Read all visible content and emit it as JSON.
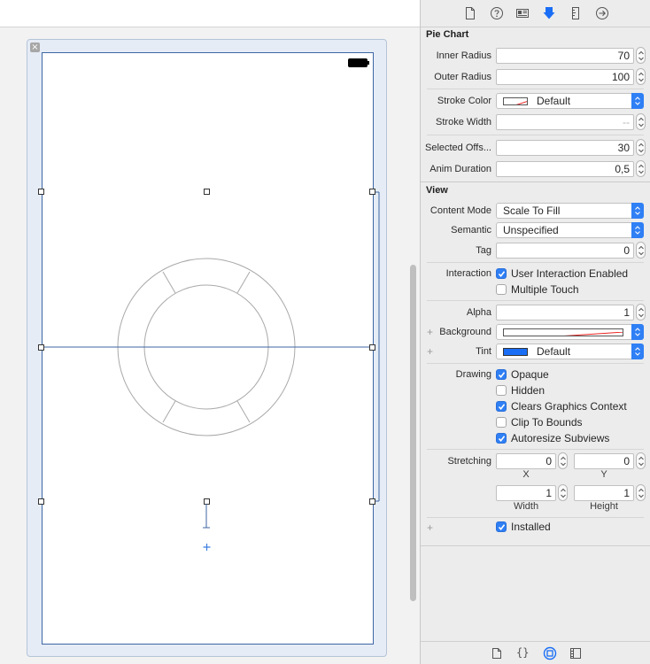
{
  "inspector": {
    "tabs": [
      "file-icon",
      "help-icon",
      "identity-icon",
      "attributes-icon",
      "size-icon",
      "connections-icon"
    ],
    "pie_chart": {
      "title": "Pie Chart",
      "inner_radius": {
        "label": "Inner Radius",
        "value": "70"
      },
      "outer_radius": {
        "label": "Outer Radius",
        "value": "100"
      },
      "stroke_color": {
        "label": "Stroke Color",
        "value": "Default"
      },
      "stroke_width": {
        "label": "Stroke Width",
        "placeholder": "--"
      },
      "selected_offset": {
        "label": "Selected Offs...",
        "value": "30"
      },
      "anim_duration": {
        "label": "Anim Duration",
        "value": "0,5"
      }
    },
    "view": {
      "title": "View",
      "content_mode": {
        "label": "Content Mode",
        "value": "Scale To Fill"
      },
      "semantic": {
        "label": "Semantic",
        "value": "Unspecified"
      },
      "tag": {
        "label": "Tag",
        "value": "0"
      },
      "interaction": {
        "label": "Interaction",
        "user_interaction": {
          "label": "User Interaction Enabled",
          "checked": true
        },
        "multiple_touch": {
          "label": "Multiple Touch",
          "checked": false
        }
      },
      "alpha": {
        "label": "Alpha",
        "value": "1"
      },
      "background": {
        "label": "Background"
      },
      "tint": {
        "label": "Tint",
        "value": "Default",
        "color": "#1a6ef5"
      },
      "drawing": {
        "label": "Drawing",
        "opaque": {
          "label": "Opaque",
          "checked": true
        },
        "hidden": {
          "label": "Hidden",
          "checked": false
        },
        "clears_graphics": {
          "label": "Clears Graphics Context",
          "checked": true
        },
        "clip_to_bounds": {
          "label": "Clip To Bounds",
          "checked": false
        },
        "autoresize": {
          "label": "Autoresize Subviews",
          "checked": true
        }
      },
      "stretching": {
        "label": "Stretching",
        "x": {
          "value": "0",
          "caption": "X"
        },
        "y": {
          "value": "0",
          "caption": "Y"
        },
        "width": {
          "value": "1",
          "caption": "Width"
        },
        "height": {
          "value": "1",
          "caption": "Height"
        }
      },
      "installed": {
        "label": "Installed",
        "checked": true
      }
    },
    "bottom_tabs": [
      "file-template-icon",
      "braces-icon",
      "object-library-icon",
      "media-library-icon"
    ]
  },
  "colors": {
    "accent": "#2f7ff5",
    "selection_blue": "#3d66a3",
    "ring_stroke": "#a9a9a9"
  }
}
